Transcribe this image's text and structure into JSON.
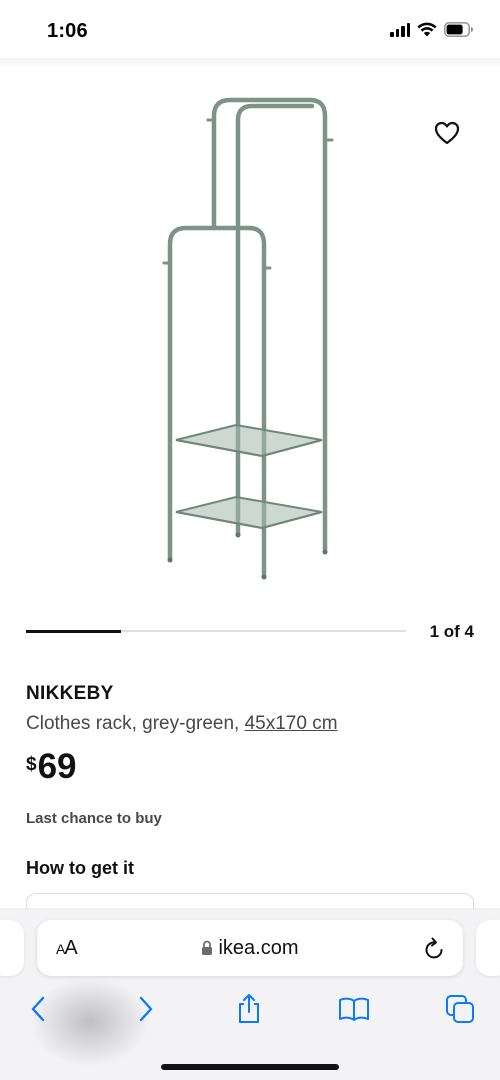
{
  "status_bar": {
    "time": "1:06",
    "icons": [
      "cellular-signal-icon",
      "wifi-icon",
      "battery-icon"
    ]
  },
  "product": {
    "image_alt": "NIKKEBY clothes rack",
    "favorite_icon": "heart-outline-icon",
    "carousel": {
      "counter": "1 of 4",
      "progress": 0.25
    },
    "name": "NIKKEBY",
    "description_prefix": "Clothes rack, grey-green, ",
    "size": "45x170 cm",
    "price_currency": "$",
    "price_amount": "69",
    "availability": "Last chance to buy",
    "how_to_get_title": "How to get it"
  },
  "browser": {
    "text_size_label_small": "A",
    "text_size_label_large": "A",
    "url": "ikea.com",
    "toolbar_icons": [
      "back-icon",
      "forward-icon",
      "share-icon",
      "bookmarks-icon",
      "tabs-icon"
    ]
  },
  "colors": {
    "rack": "#7c9488",
    "rack_dark": "#5f766a",
    "ios_blue": "#0a7aff"
  }
}
